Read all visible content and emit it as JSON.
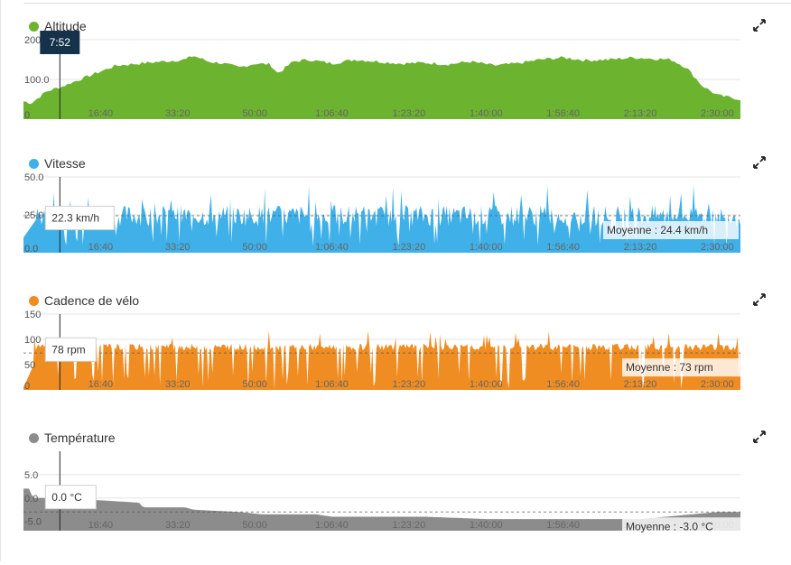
{
  "chart_data": [
    {
      "type": "area",
      "title": "Altitude",
      "color": "#6cb32f",
      "ylim": [
        0,
        200
      ],
      "yticks": [
        "200.0",
        "100.0",
        "0"
      ],
      "xticks": [
        "16:40",
        "33:20",
        "50:00",
        "1:06:40",
        "1:23:20",
        "1:40:00",
        "1:56:40",
        "2:13:20",
        "2:30:00"
      ],
      "cursor_label": "7:52",
      "x_seconds": [
        0,
        100,
        200,
        300,
        472,
        600,
        800,
        1000,
        1200,
        1500,
        1800,
        2100,
        2200,
        2400,
        2600,
        2800,
        3000,
        3200,
        3300,
        3500,
        3700,
        4000,
        4300,
        4600,
        4900,
        5200,
        5500,
        5800,
        6100,
        6400,
        6700,
        7000,
        7300,
        7600,
        7900,
        8200,
        8400,
        8600,
        8800,
        9000,
        9300
      ],
      "values": [
        45,
        40,
        55,
        70,
        80,
        90,
        105,
        120,
        135,
        140,
        145,
        150,
        160,
        145,
        140,
        130,
        140,
        138,
        115,
        145,
        150,
        140,
        150,
        145,
        140,
        142,
        138,
        145,
        135,
        140,
        150,
        155,
        148,
        150,
        155,
        152,
        150,
        130,
        85,
        60,
        50
      ]
    },
    {
      "type": "area",
      "title": "Vitesse",
      "color": "#3fb0e8",
      "ylim": [
        0,
        50
      ],
      "yticks": [
        "50.0",
        "25.0",
        "0.0"
      ],
      "xticks": [
        "16:40",
        "33:20",
        "50:00",
        "1:06:40",
        "1:23:20",
        "1:40:00",
        "1:56:40",
        "2:13:20",
        "2:30:00"
      ],
      "average": 24.4,
      "average_label": "Moyenne : 24.4 km/h",
      "cursor_label": "22.3 km/h",
      "cursor_value": 22.3
    },
    {
      "type": "area",
      "title": "Cadence de vélo",
      "color": "#ef8d23",
      "ylim": [
        0,
        150
      ],
      "yticks": [
        "150",
        "100",
        "50",
        "0"
      ],
      "xticks": [
        "16:40",
        "33:20",
        "50:00",
        "1:06:40",
        "1:23:20",
        "1:40:00",
        "1:56:40",
        "2:13:20",
        "2:30:00"
      ],
      "average": 73,
      "average_label": "Moyenne : 73 rpm",
      "cursor_label": "78 rpm",
      "cursor_value": 78
    },
    {
      "type": "area",
      "title": "Température",
      "color": "#8c8c8c",
      "ylim": [
        -7,
        10
      ],
      "yticks": [
        "5.0",
        "0.0",
        "-5.0"
      ],
      "xticks": [
        "16:40",
        "33:20",
        "50:00",
        "1:06:40",
        "1:23:20",
        "1:40:00",
        "1:56:40",
        "2:13:20",
        "2:30:00"
      ],
      "average": -3.0,
      "average_label": "Moyenne : -3.0 °C",
      "cursor_label": "0.0 °C",
      "cursor_value": 0.0,
      "x_seconds": [
        0,
        80,
        120,
        500,
        1500,
        1550,
        1800,
        2100,
        2200,
        2800,
        3100,
        3800,
        4000,
        4200,
        4800,
        5200,
        6000,
        7000,
        8000,
        9000,
        9300
      ],
      "values": [
        2,
        2,
        0,
        0,
        -1,
        -2,
        -2,
        -2,
        -2.5,
        -3,
        -3.5,
        -3.5,
        -4,
        -4,
        -4,
        -4,
        -4.5,
        -4.5,
        -4.5,
        -3,
        -3
      ]
    }
  ],
  "cursor_seconds": 472,
  "x_max_seconds": 9300
}
